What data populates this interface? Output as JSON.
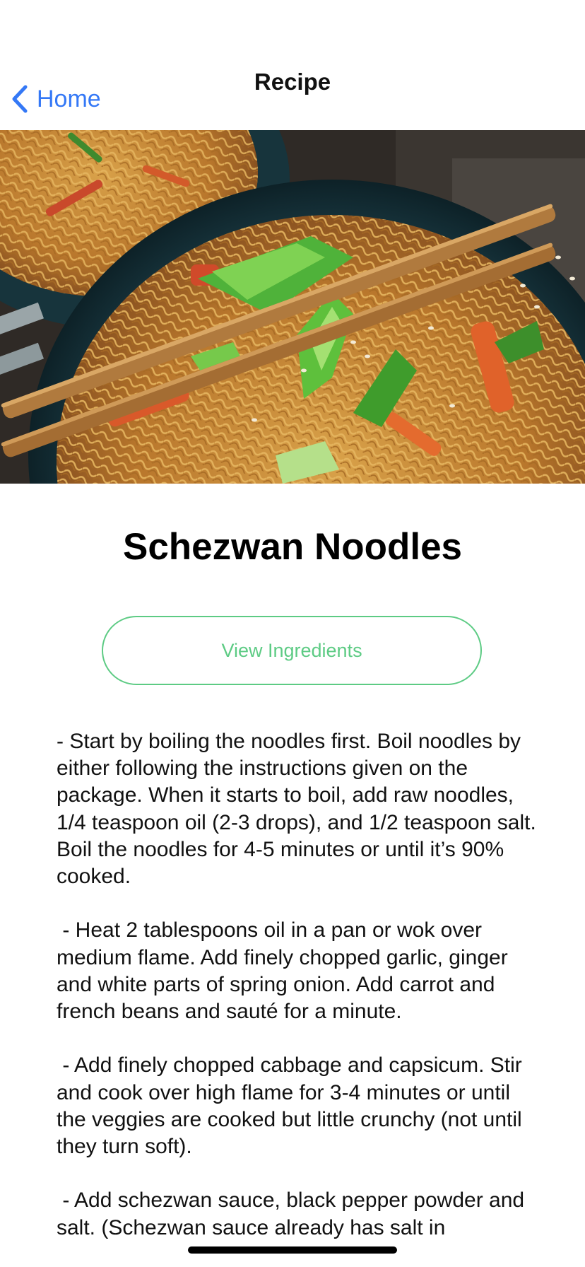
{
  "nav": {
    "back_label": "Home",
    "title": "Recipe"
  },
  "hero": {
    "image_alt": "Bowl of schezwan noodles with chopsticks"
  },
  "recipe": {
    "name": "Schezwan Noodles",
    "view_ingredients_label": "View Ingredients",
    "instructions": "- Start by boiling the noodles first. Boil noodles by either following the instructions given on the package. When it starts to boil, add raw noodles, 1/4 teaspoon oil (2-3 drops), and 1/2 teaspoon salt. Boil the noodles for 4-5 minutes or until it’s 90% cooked.\n\n - Heat 2 tablespoons oil in a pan or wok over medium flame. Add finely chopped garlic, ginger and white parts of spring onion. Add carrot and french beans and sauté for a minute.\n\n - Add finely chopped cabbage and capsicum. Stir and cook over high flame for 3-4 minutes or until the veggies are cooked but little crunchy (not until they turn soft).\n\n - Add schezwan sauce, black pepper powder and salt. (Schezwan sauce already has salt in"
  },
  "colors": {
    "accent_blue": "#3478f6",
    "button_green": "#5dcb84"
  },
  "icons": {
    "back": "chevron-left-icon"
  }
}
